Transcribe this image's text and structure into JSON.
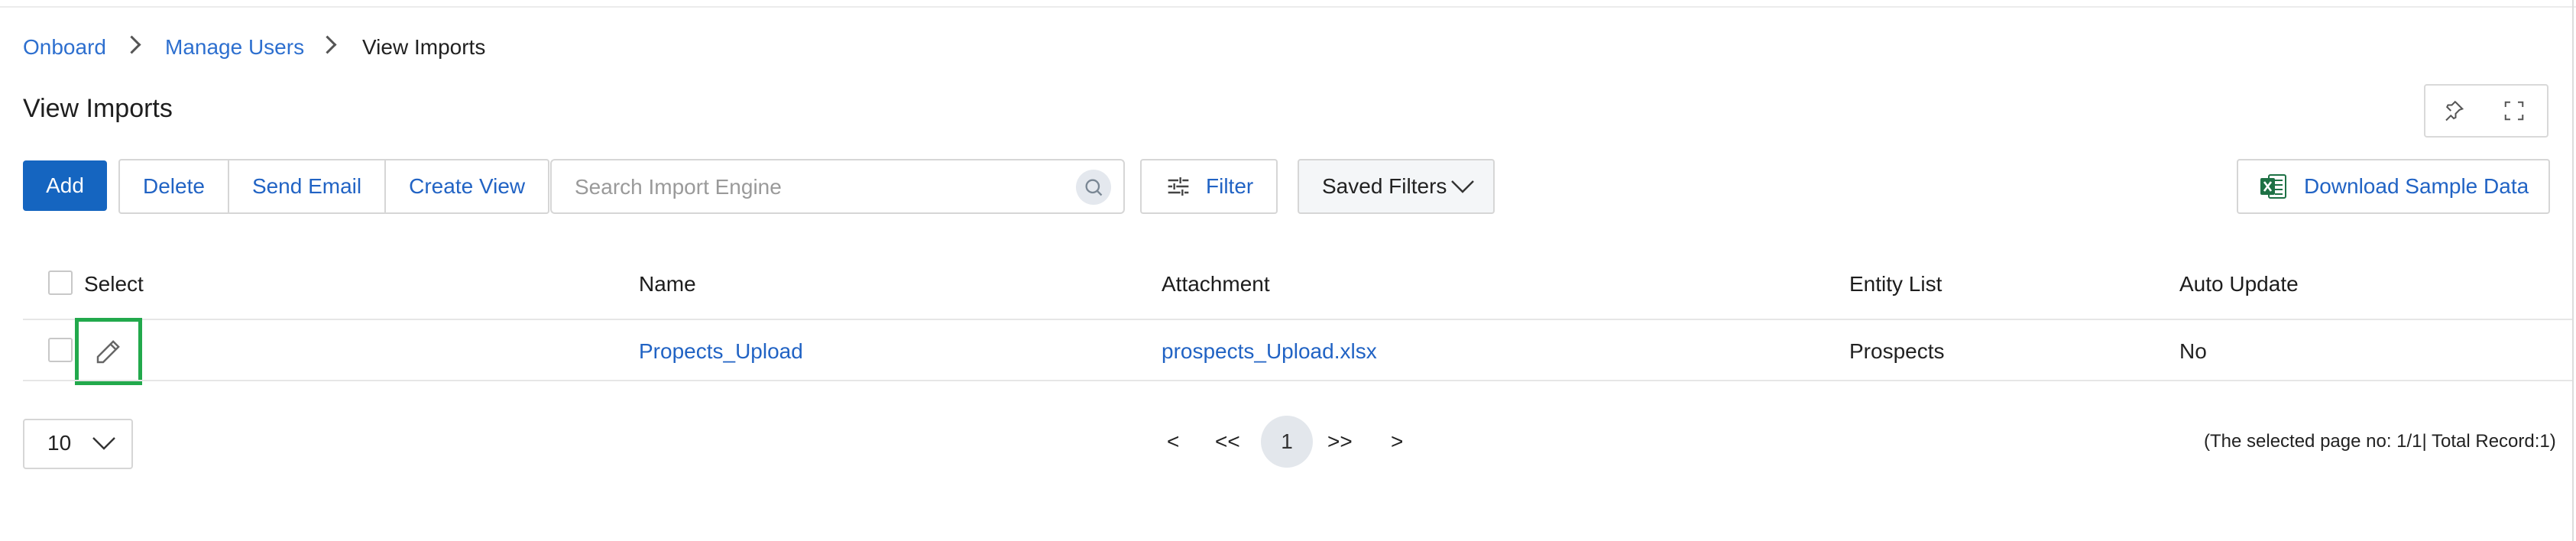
{
  "breadcrumb": {
    "items": [
      "Onboard",
      "Manage Users",
      "View Imports"
    ]
  },
  "page": {
    "title": "View Imports"
  },
  "toolbar": {
    "add_label": "Add",
    "delete_label": "Delete",
    "send_email_label": "Send Email",
    "create_view_label": "Create View",
    "search_placeholder": "Search Import Engine",
    "filter_label": "Filter",
    "saved_filters_label": "Saved Filters",
    "download_label": "Download Sample Data"
  },
  "table": {
    "columns": [
      "Select",
      "Name",
      "Attachment",
      "Entity List",
      "Auto Update"
    ],
    "rows": [
      {
        "name": "Propects_Upload",
        "attachment": "prospects_Upload.xlsx",
        "entity_list": "Prospects",
        "auto_update": "No"
      }
    ]
  },
  "pagination": {
    "page_size": "10",
    "prev": "<",
    "first": "<<",
    "current": "1",
    "last": ">>",
    "next": ">",
    "record_info": "(The selected page no: 1/1| Total Record:1)"
  },
  "icons": {
    "pin": "pin-icon",
    "expand": "expand-icon",
    "search": "search-icon",
    "filter": "filter-sliders-icon",
    "chevron": "chevron-down-icon",
    "excel": "excel-icon",
    "edit": "pencil-icon"
  },
  "colors": {
    "primary": "#1565c0",
    "link": "#2163c4",
    "highlight": "#22a94c",
    "excel": "#1e7145"
  }
}
